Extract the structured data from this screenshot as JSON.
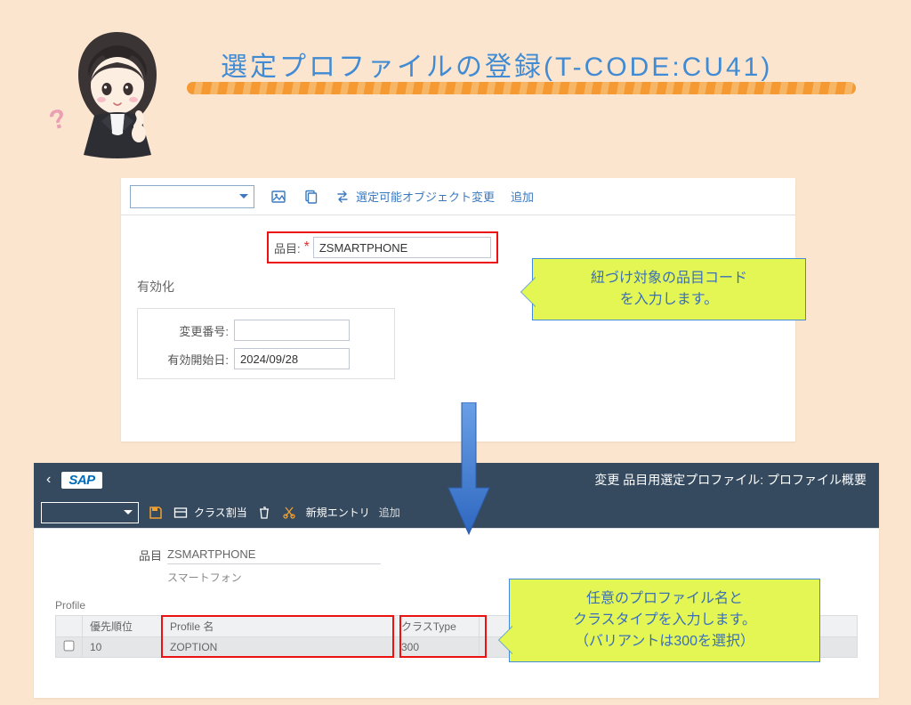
{
  "header": {
    "title": "選定プロファイルの登録(T-CODE:CU41)"
  },
  "panel1": {
    "toolbar": {
      "change_objects": "選定可能オブジェクト変更",
      "add": "追加"
    },
    "material_label": "品目:",
    "material_value": "ZSMARTPHONE",
    "activation_title": "有効化",
    "change_no_label": "変更番号:",
    "change_no_value": "",
    "valid_from_label": "有効開始日:",
    "valid_from_value": "2024/09/28"
  },
  "callout1": {
    "line1": "紐づけ対象の品目コード",
    "line2": "を入力します。"
  },
  "panel2": {
    "title": "変更 品目用選定プロファイル: プロファイル概要",
    "toolbar": {
      "class_assign": "クラス割当",
      "new_entry": "新規エントリ",
      "add": "追加"
    },
    "material_label": "品目",
    "material_value": "ZSMARTPHONE",
    "material_desc": "スマートフォン",
    "profile_section": "Profile",
    "columns": {
      "priority": "優先順位",
      "profile_name": "Profile 名",
      "class_type": "クラスType",
      "extra": ""
    },
    "row": {
      "priority": "10",
      "profile_name": "ZOPTION",
      "class_type": "300"
    }
  },
  "callout2": {
    "line1": "任意のプロファイル名と",
    "line2": "クラスタイプを入力します。",
    "line3": "（バリアントは300を選択）"
  }
}
